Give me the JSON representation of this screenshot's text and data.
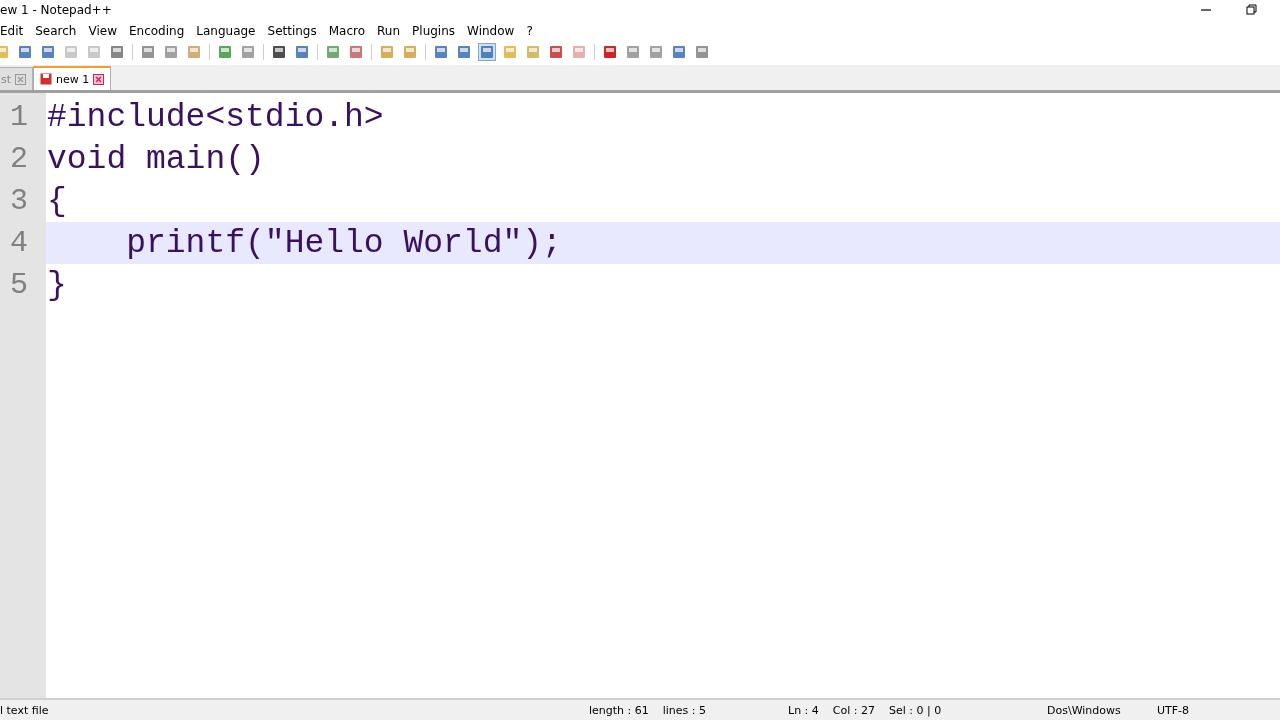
{
  "window": {
    "title": "ew 1 - Notepad++"
  },
  "menu": [
    "Edit",
    "Search",
    "View",
    "Encoding",
    "Language",
    "Settings",
    "Macro",
    "Run",
    "Plugins",
    "Window",
    "?"
  ],
  "tabs": [
    {
      "label": "st",
      "selected": false
    },
    {
      "label": "new 1",
      "selected": true
    }
  ],
  "editor": {
    "lines": [
      {
        "number": "1",
        "text": "#include<stdio.h>",
        "current": false
      },
      {
        "number": "2",
        "text": "void main()",
        "current": false
      },
      {
        "number": "3",
        "text": "{",
        "current": false
      },
      {
        "number": "4",
        "text": "    printf(\"Hello World\");",
        "current": true
      },
      {
        "number": "5",
        "text": "}",
        "current": false
      }
    ]
  },
  "status_bar": [
    "l text file",
    "length : 61    lines : 5",
    "Ln : 4    Col : 27    Sel : 0 | 0",
    "Dos\\Windows",
    "UTF-8"
  ]
}
